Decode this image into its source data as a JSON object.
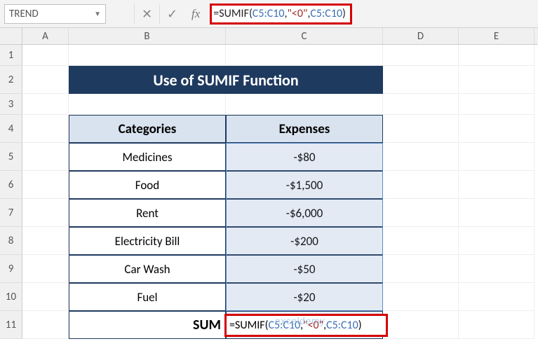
{
  "name_box": "TREND",
  "formula_bar": {
    "prefix": "=",
    "fn": "SUMIF",
    "open": "(",
    "ref1": "C5:C10",
    "comma1": ",",
    "str": "\"<0\"",
    "comma2": ",",
    "ref2": "C5:C10",
    "close": ")"
  },
  "columns": {
    "A": "A",
    "B": "B",
    "C": "C",
    "D": "D",
    "E": "E"
  },
  "rows": [
    "1",
    "2",
    "3",
    "4",
    "5",
    "6",
    "7",
    "8",
    "9",
    "10",
    "11"
  ],
  "title": "Use of SUMIF Function",
  "headers": {
    "cat": "Categories",
    "exp": "Expenses"
  },
  "data": [
    {
      "cat": "Medicines",
      "exp": "-$80"
    },
    {
      "cat": "Food",
      "exp": "-$1,500"
    },
    {
      "cat": "Rent",
      "exp": "-$6,000"
    },
    {
      "cat": "Electricity Bill",
      "exp": "-$200"
    },
    {
      "cat": "Car Wash",
      "exp": "-$50"
    },
    {
      "cat": "Fuel",
      "exp": "-$20"
    }
  ],
  "sum_label": "SUM",
  "cell_formula": {
    "prefix": "=SUMIF(",
    "ref1": "C5:C10",
    "comma1": ",",
    "str": "\"<0\"",
    "comma2": ",",
    "ref2": "C5:C10",
    "close": ")"
  },
  "watermark": "exceldemy",
  "chart_data": {
    "type": "table",
    "title": "Use of SUMIF Function",
    "columns": [
      "Categories",
      "Expenses"
    ],
    "rows": [
      [
        "Medicines",
        -80
      ],
      [
        "Food",
        -1500
      ],
      [
        "Rent",
        -6000
      ],
      [
        "Electricity Bill",
        -200
      ],
      [
        "Car Wash",
        -50
      ],
      [
        "Fuel",
        -20
      ]
    ],
    "formula": "=SUMIF(C5:C10,\"<0\",C5:C10)"
  }
}
